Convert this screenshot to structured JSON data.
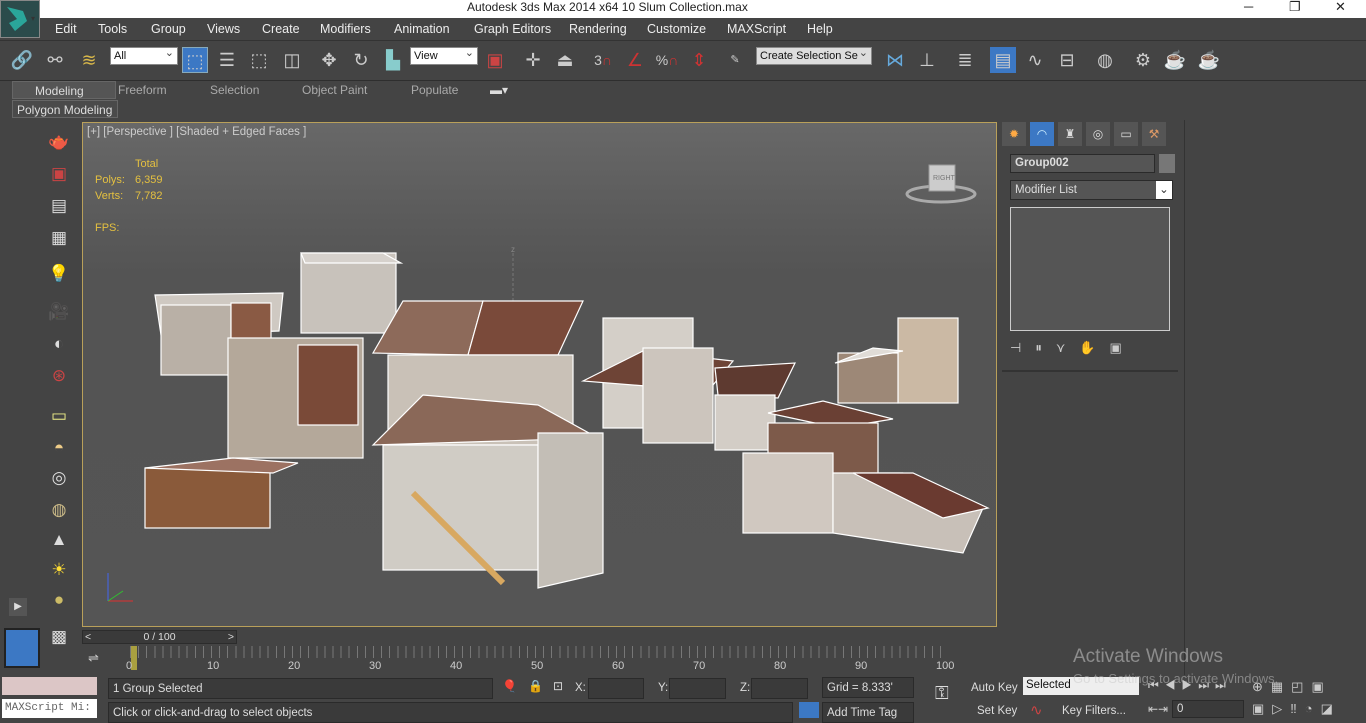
{
  "window": {
    "title": "Autodesk 3ds Max  2014 x64     10 Slum Collection.max",
    "minimize": "─",
    "restore": "❐",
    "close": "✕"
  },
  "menu": [
    "Edit",
    "Tools",
    "Group",
    "Views",
    "Create",
    "Modifiers",
    "Animation",
    "Graph Editors",
    "Rendering",
    "Customize",
    "MAXScript",
    "Help"
  ],
  "toolbar": {
    "selection_filter": "All",
    "ref_coord": "View",
    "named_selection": "Create Selection Se",
    "snap_label": "3",
    "percent_label": "%"
  },
  "ribbon": {
    "tabs": [
      "Modeling",
      "Freeform",
      "Selection",
      "Object Paint",
      "Populate"
    ],
    "active": "Modeling",
    "subpanel": "Polygon Modeling"
  },
  "viewport": {
    "label": "[+] [Perspective ] [Shaded + Edged Faces ]",
    "stats": {
      "total": "Total",
      "polys_label": "Polys:",
      "polys": "6,359",
      "verts_label": "Verts:",
      "verts": "7,782",
      "fps_label": "FPS:"
    },
    "viewcube": "RIGHT",
    "axis_z": "z"
  },
  "command_panel": {
    "object_name": "Group002",
    "modifier_list": "Modifier List"
  },
  "timeline": {
    "frame": "0 / 100",
    "ticks": [
      "0",
      "10",
      "20",
      "30",
      "40",
      "50",
      "60",
      "70",
      "80",
      "90",
      "100"
    ]
  },
  "status": {
    "maxscript": "MAXScript Mi:",
    "selection": "1 Group Selected",
    "prompt": "Click or click-and-drag to select objects",
    "x_label": "X:",
    "y_label": "Y:",
    "z_label": "Z:",
    "grid": "Grid = 8.333'",
    "add_time_tag": "Add Time Tag",
    "auto_key": "Auto Key",
    "set_key": "Set Key",
    "key_mode": "Selected",
    "key_filters": "Key Filters...",
    "current_frame": "0"
  },
  "watermark": {
    "title": "Activate Windows",
    "subtitle": "Go to Settings to activate Windows."
  }
}
